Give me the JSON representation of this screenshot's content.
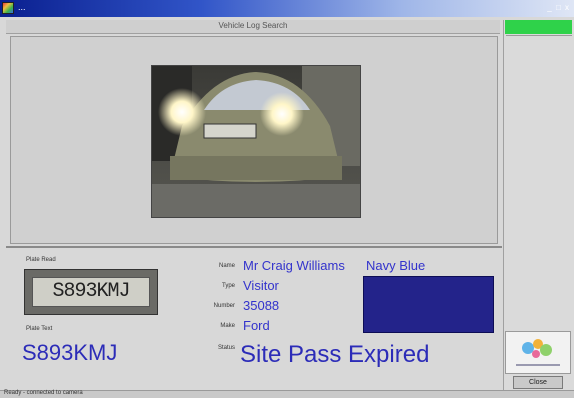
{
  "window": {
    "title": "...",
    "controls": "_ □ x"
  },
  "header": {
    "text": "Vehicle Log   Search"
  },
  "plate_section": {
    "image_label": "Plate Read",
    "plate_label": "Plate Text",
    "plate_image_text": "S893KMJ",
    "plate_value": "S893KMJ"
  },
  "details": {
    "name_label": "Name",
    "name_value": "Mr Craig Williams",
    "colour_name": "Navy Blue",
    "type_label": "Type",
    "type_value": "Visitor",
    "number_label": "Number",
    "number_value": "35088",
    "make_label": "Make",
    "make_value": "Ford",
    "status_label": "Status",
    "status_value": "Site Pass Expired",
    "colour_hex": "#23238a"
  },
  "side_panel": {
    "button_label": "Close"
  },
  "statusbar": {
    "text": "Ready - connected to camera"
  }
}
